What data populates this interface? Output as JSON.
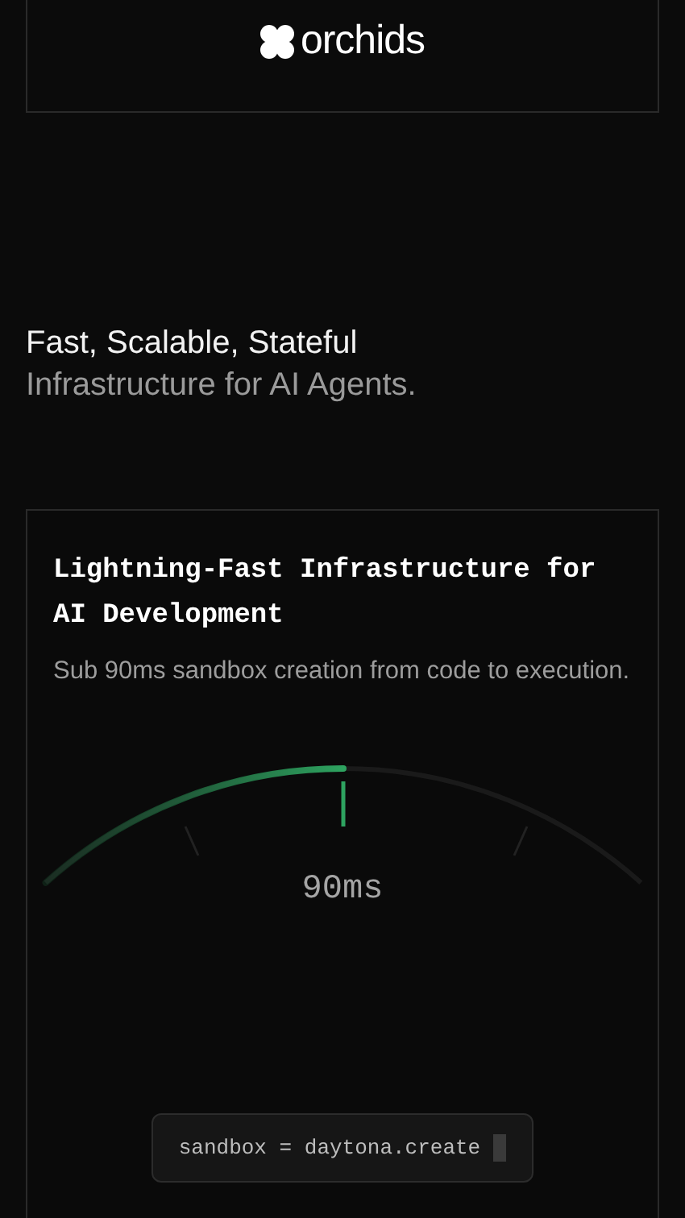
{
  "header": {
    "logo_text": "orchids"
  },
  "hero": {
    "title": "Fast, Scalable, Stateful",
    "subtitle": "Infrastructure for AI Agents."
  },
  "feature_card": {
    "title": "Lightning-Fast Infrastructure for AI Development",
    "description": "Sub 90ms sandbox creation from code to execution.",
    "gauge": {
      "level": 0.5,
      "reading": "90ms"
    },
    "code": "sandbox = daytona.create"
  }
}
